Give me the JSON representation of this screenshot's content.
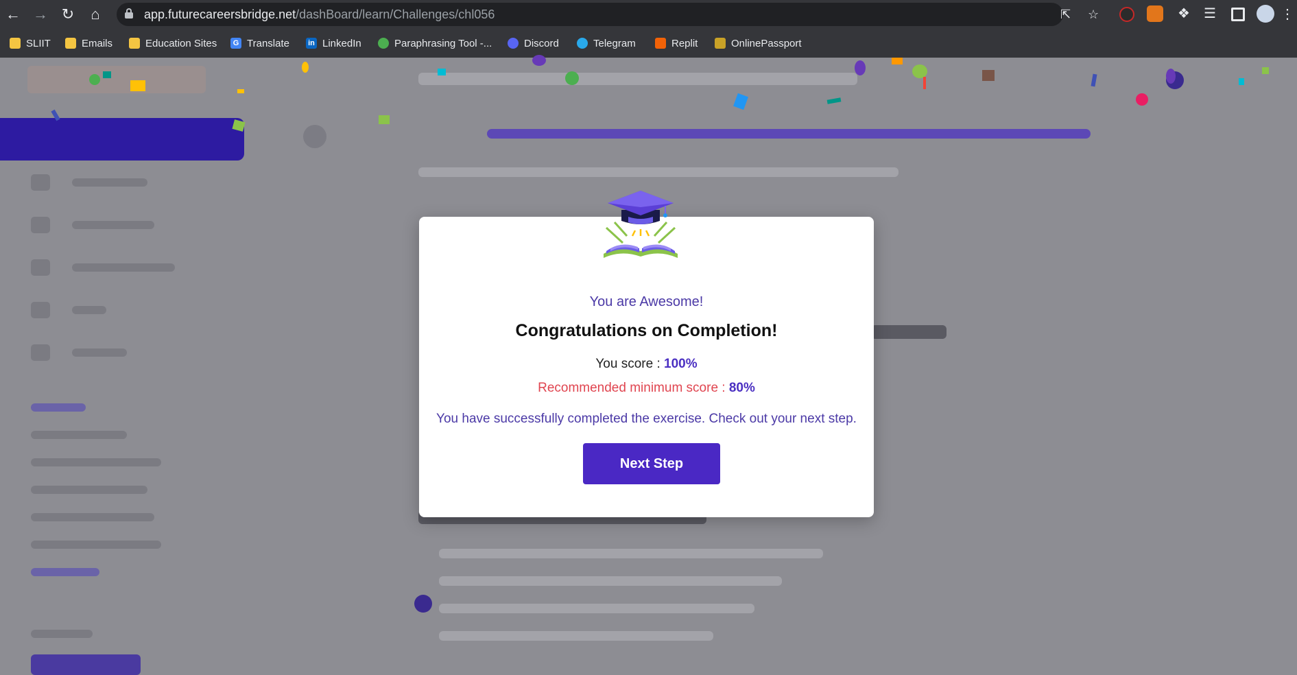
{
  "browser": {
    "url_host": "app.futurecareersbridge.net",
    "url_path": "/dashBoard/learn/Challenges/chl056",
    "bookmarks": [
      {
        "label": "SLIIT",
        "icon": "folder-icon",
        "color": "#f4c542"
      },
      {
        "label": "Emails",
        "icon": "folder-icon",
        "color": "#f4c542"
      },
      {
        "label": "Education Sites",
        "icon": "folder-icon",
        "color": "#f4c542"
      },
      {
        "label": "Translate",
        "icon": "translate-icon",
        "color": "#4285f4"
      },
      {
        "label": "LinkedIn",
        "icon": "linkedin-icon",
        "color": "#0a66c2"
      },
      {
        "label": "Paraphrasing Tool -...",
        "icon": "quillbot-icon",
        "color": "#4caf50"
      },
      {
        "label": "Discord",
        "icon": "discord-icon",
        "color": "#5865f2"
      },
      {
        "label": "Telegram",
        "icon": "telegram-icon",
        "color": "#29a9eb"
      },
      {
        "label": "Replit",
        "icon": "replit-icon",
        "color": "#f26207"
      },
      {
        "label": "OnlinePassport",
        "icon": "passport-icon",
        "color": "#c9a227"
      }
    ]
  },
  "modal": {
    "subtitle": "You are Awesome!",
    "title": "Congratulations on Completion!",
    "score_label": "You score :",
    "score_value": "100%",
    "min_label": "Recommended minimum score :",
    "min_value": "80%",
    "message": "You have successfully completed the exercise. Check out your next step.",
    "button_label": "Next Step",
    "icon": "graduation-book-icon"
  },
  "colors": {
    "accent": "#4a28c4",
    "subtitle": "#4b39a6",
    "warning": "#e04550"
  }
}
